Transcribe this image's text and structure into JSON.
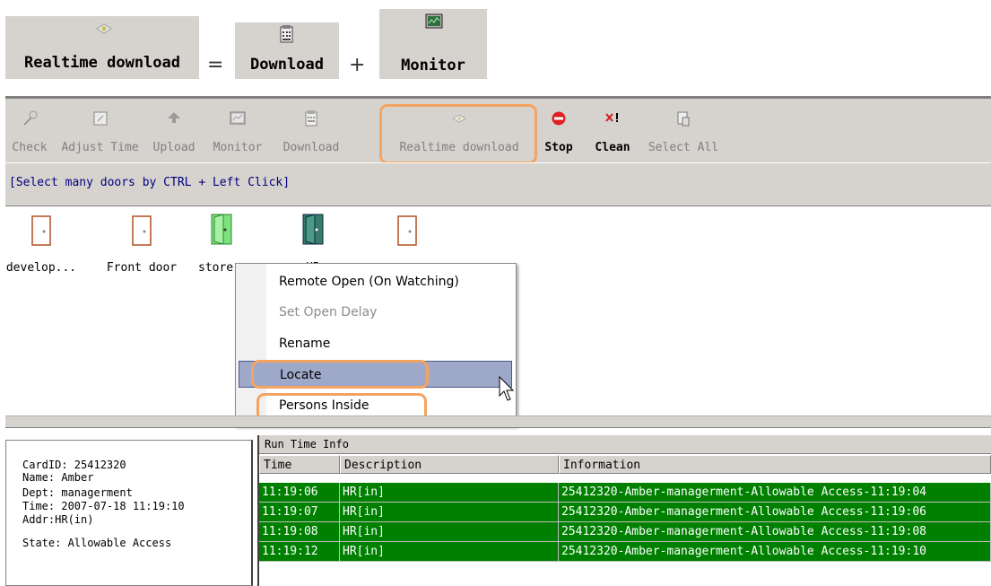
{
  "equation": {
    "realtime_label": "Realtime download",
    "equals": "=",
    "download_label": "Download",
    "plus": "+",
    "monitor_label": "Monitor"
  },
  "toolbar": {
    "items": [
      {
        "label": "Check",
        "icon": "wand-icon",
        "enabled": false
      },
      {
        "label": "Adjust Time",
        "icon": "clock-icon",
        "enabled": false
      },
      {
        "label": "Upload",
        "icon": "upload-icon",
        "enabled": false
      },
      {
        "label": "Monitor",
        "icon": "monitor-icon",
        "enabled": false
      },
      {
        "label": "Download",
        "icon": "download-icon",
        "enabled": false
      },
      {
        "label": "Realtime download",
        "icon": "realtime-download-icon",
        "enabled": false
      },
      {
        "label": "Stop",
        "icon": "stop-icon",
        "enabled": true
      },
      {
        "label": "Clean",
        "icon": "clean-icon",
        "enabled": true
      },
      {
        "label": "Select All",
        "icon": "select-all-icon",
        "enabled": false
      }
    ],
    "hint": "[Select many doors by CTRL + Left Click]"
  },
  "doors": [
    {
      "label": "develop...",
      "state": "closed"
    },
    {
      "label": "Front door",
      "state": "closed"
    },
    {
      "label": "store",
      "state": "open-selected"
    },
    {
      "label": "HR",
      "state": "open-dark"
    },
    {
      "label": "",
      "state": "closed"
    }
  ],
  "context_menu": {
    "items": [
      {
        "label": "Remote Open (On Watching)",
        "enabled": true
      },
      {
        "label": "Set Open Delay",
        "enabled": false
      },
      {
        "label": "Rename",
        "enabled": true
      },
      {
        "label": "Locate",
        "enabled": true,
        "selected": true
      },
      {
        "label": "Persons Inside",
        "enabled": true
      }
    ]
  },
  "card_info": {
    "card_id": "CardID: 25412320",
    "name": "Name: Amber",
    "dept": "Dept: managerment",
    "time": "Time: 2007-07-18 11:19:10",
    "addr": "Addr:HR(in)",
    "state": "State: Allowable Access"
  },
  "run_time_info": {
    "title": "Run Time Info",
    "columns": [
      "Time",
      "Description",
      "Information"
    ],
    "rows": [
      {
        "time": "11:19:06",
        "description": "HR[in]",
        "information": "25412320-Amber-managerment-Allowable Access-11:19:04"
      },
      {
        "time": "11:19:07",
        "description": "HR[in]",
        "information": "25412320-Amber-managerment-Allowable Access-11:19:06"
      },
      {
        "time": "11:19:08",
        "description": "HR[in]",
        "information": "25412320-Amber-managerment-Allowable Access-11:19:08"
      },
      {
        "time": "11:19:12",
        "description": "HR[in]",
        "information": "25412320-Amber-managerment-Allowable Access-11:19:10"
      }
    ],
    "row_color": "#008000"
  },
  "highlight_color": "#f4a460"
}
